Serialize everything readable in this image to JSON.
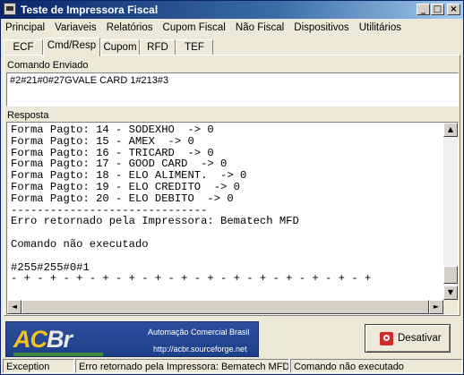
{
  "window": {
    "title": "Teste de Impressora Fiscal"
  },
  "menu": [
    "Principal",
    "Variaveis",
    "Relatórios",
    "Cupom Fiscal",
    "Não Fiscal",
    "Dispositivos",
    "Utilitários"
  ],
  "tabs": [
    "ECF",
    "Cmd/Resp",
    "Cupom",
    "RFD",
    "TEF"
  ],
  "active_tab": "Cmd/Resp",
  "comando": {
    "label": "Comando Enviado",
    "value": "#2#21#0#27GVALE CARD     1#213#3"
  },
  "resposta": {
    "label": "Resposta",
    "lines": [
      "Forma Pagto: 14 - SODEXHO  -> 0",
      "Forma Pagto: 15 - AMEX  -> 0",
      "Forma Pagto: 16 - TRICARD  -> 0",
      "Forma Pagto: 17 - GOOD CARD  -> 0",
      "Forma Pagto: 18 - ELO ALIMENT.  -> 0",
      "Forma Pagto: 19 - ELO CREDITO  -> 0",
      "Forma Pagto: 20 - ELO DEBITO  -> 0",
      "------------------------------",
      "Erro retornado pela Impressora: Bematech MFD",
      "",
      "Comando não executado",
      "",
      "#255#255#0#1",
      "- + - + - + - + - + - + - + - + - + - + - + - + - + - +"
    ]
  },
  "logo": {
    "brand_a": "AC",
    "brand_b": "Br",
    "tagline": "Automação Comercial Brasil",
    "url": "http://acbr.sourceforge.net"
  },
  "desativar_label": "Desativar",
  "status": [
    "Exception",
    "Erro retornado pela Impressora: Bematech MFD",
    "Comando não executado"
  ],
  "titlebar_buttons": [
    "_",
    "□",
    "×"
  ],
  "scroll_arrows": {
    "up": "▲",
    "down": "▼",
    "left": "◄",
    "right": "►"
  },
  "colors": {
    "title_bar": "#0a246a",
    "panel": "#ece9d8",
    "logo_bg": "#1e3f88",
    "logo_accent": "#f3c21e",
    "desativar_icon": "#d12a2a"
  }
}
